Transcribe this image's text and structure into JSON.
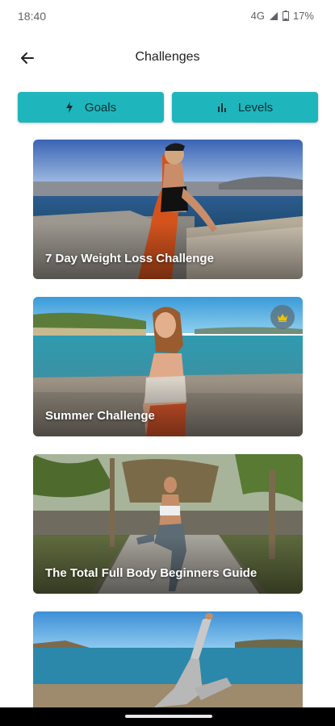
{
  "status_bar": {
    "time": "18:40",
    "network": "4G",
    "battery": "17%"
  },
  "header": {
    "title": "Challenges",
    "back_icon": "arrow-left-icon"
  },
  "filters": {
    "goals_label": "Goals",
    "goals_icon": "bolt-icon",
    "levels_label": "Levels",
    "levels_icon": "bar-chart-icon"
  },
  "colors": {
    "accent": "#1fb5bd"
  },
  "challenges": [
    {
      "title": "7 Day Weight Loss Challenge",
      "premium": false
    },
    {
      "title": "Summer Challenge",
      "premium": true,
      "badge_icon": "crown-icon"
    },
    {
      "title": "The Total Full Body Beginners Guide",
      "premium": false
    },
    {
      "title": "",
      "premium": false
    }
  ]
}
